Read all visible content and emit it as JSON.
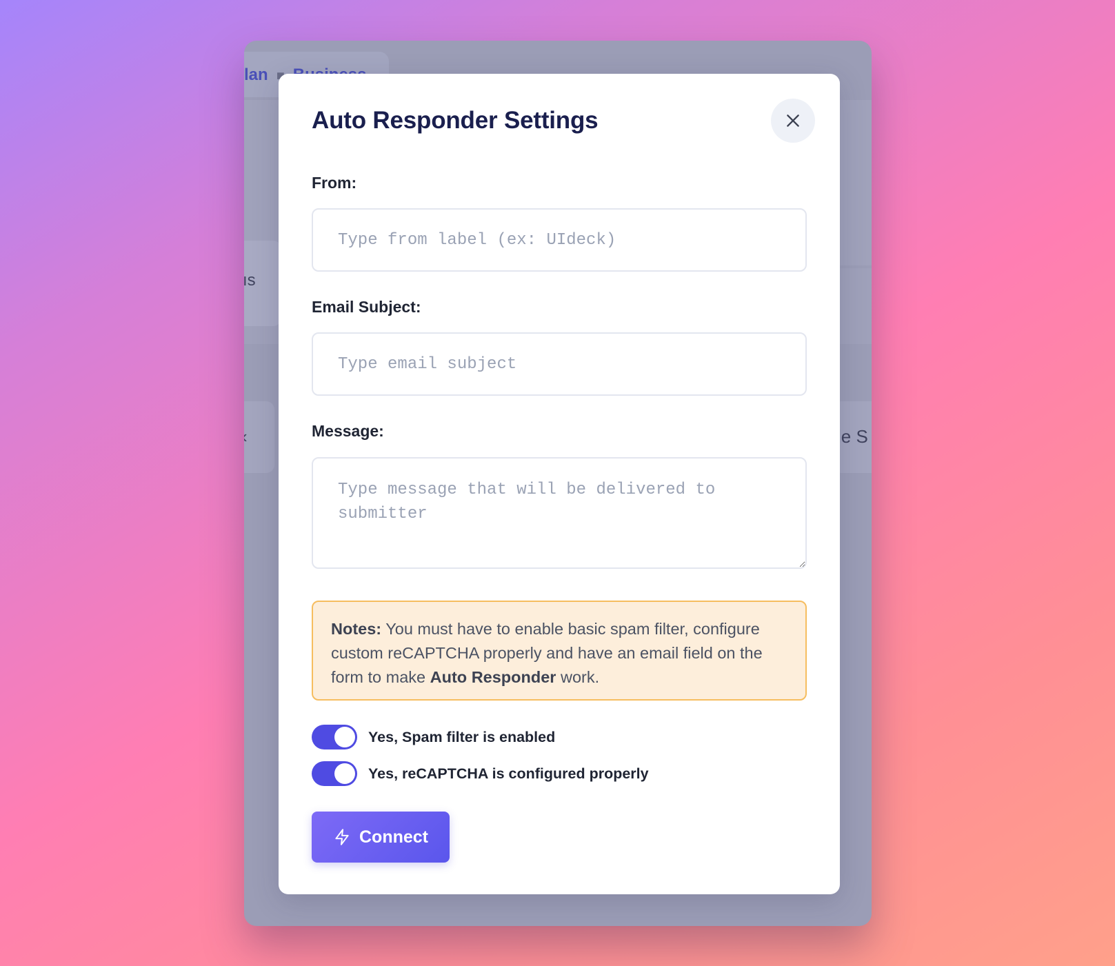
{
  "background": {
    "plan_text": "lan",
    "plan_badge": "Business",
    "chip_left": "ıs",
    "card_left": "‹",
    "card_right": "le S"
  },
  "modal": {
    "title": "Auto Responder Settings",
    "from": {
      "label": "From:",
      "value": "",
      "placeholder": "Type from label (ex: UIdeck)"
    },
    "subject": {
      "label": "Email Subject:",
      "value": "",
      "placeholder": "Type email subject"
    },
    "message": {
      "label": "Message:",
      "value": "",
      "placeholder": "Type message that will be delivered to submitter"
    },
    "notes": {
      "lead": "Notes:",
      "text_before": " You must have to enable basic spam filter, configure custom reCAPTCHA properly and have an email field on the form to make ",
      "emphasis": "Auto Responder",
      "text_after": " work."
    },
    "toggles": [
      {
        "label": "Yes, Spam filter is enabled",
        "on": true
      },
      {
        "label": "Yes, reCAPTCHA is configured properly",
        "on": true
      }
    ],
    "connect_label": "Connect"
  },
  "colors": {
    "accent": "#4f4be2",
    "title": "#1a1f4e",
    "notes_bg": "#fdeedb",
    "notes_border": "#f6bd5f"
  },
  "icons": {
    "close": "close-icon",
    "connect": "lightning-icon"
  }
}
